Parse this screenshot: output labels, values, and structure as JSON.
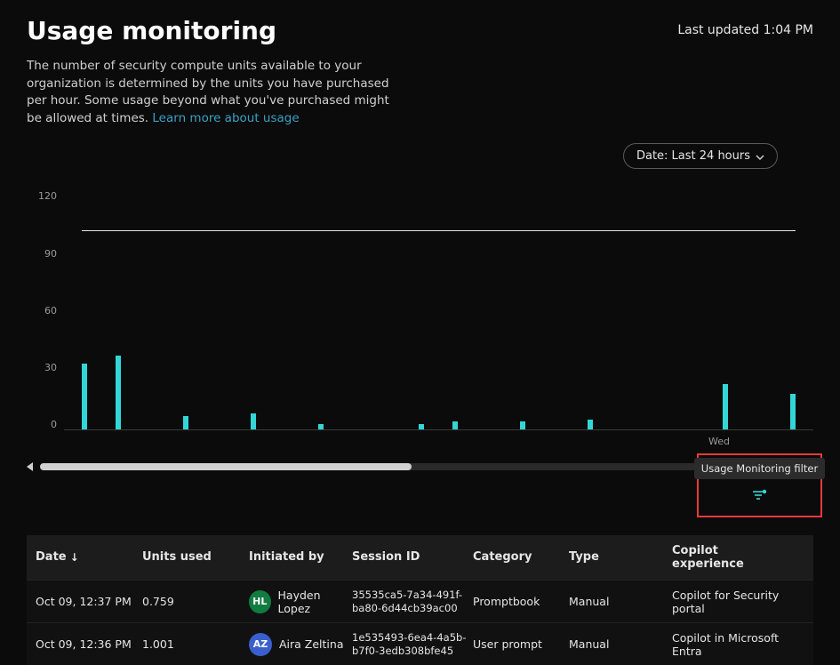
{
  "header": {
    "title": "Usage monitoring",
    "last_updated": "Last updated 1:04 PM"
  },
  "description": {
    "text": "The number of security compute units available to your organization is determined by the units you have purchased per hour. Some usage beyond what you've purchased might be allowed at times. ",
    "link_text": "Learn more about usage"
  },
  "date_filter": {
    "label": "Date: Last 24 hours"
  },
  "chart_data": {
    "type": "bar",
    "ylabel": "",
    "ylim": [
      0,
      120
    ],
    "y_ticks": [
      120,
      90,
      60,
      30,
      0
    ],
    "capacity_line": 100,
    "values": [
      33,
      37,
      0,
      7,
      0,
      8,
      0,
      3,
      0,
      0,
      3,
      4,
      0,
      4,
      0,
      5,
      0,
      0,
      0,
      23,
      0,
      18
    ],
    "x_labels": [
      {
        "pos": 0.86,
        "text": "Wed"
      }
    ]
  },
  "scrollbar": {
    "thumb_left_pct": 0,
    "thumb_width_pct": 48
  },
  "filter_tooltip": "Usage Monitoring filter",
  "table": {
    "columns": {
      "date": "Date",
      "units": "Units used",
      "initiated": "Initiated by",
      "session": "Session ID",
      "category": "Category",
      "type": "Type",
      "copilot": "Copilot experience"
    },
    "rows": [
      {
        "date": "Oct 09, 12:37 PM",
        "units": "0.759",
        "initiated_initials": "HL",
        "initiated_name": "Hayden Lopez",
        "initiated_color": "#107c41",
        "session": "35535ca5-7a34-491f-ba80-6d44cb39ac00",
        "category": "Promptbook",
        "type": "Manual",
        "copilot": "Copilot for Security portal"
      },
      {
        "date": "Oct 09, 12:36 PM",
        "units": "1.001",
        "initiated_initials": "AZ",
        "initiated_name": "Aira Zeltina",
        "initiated_color": "#3a5fcd",
        "session": "1e535493-6ea4-4a5b-b7f0-3edb308bfe45",
        "category": "User prompt",
        "type": "Manual",
        "copilot": "Copilot in Microsoft Entra"
      }
    ]
  }
}
